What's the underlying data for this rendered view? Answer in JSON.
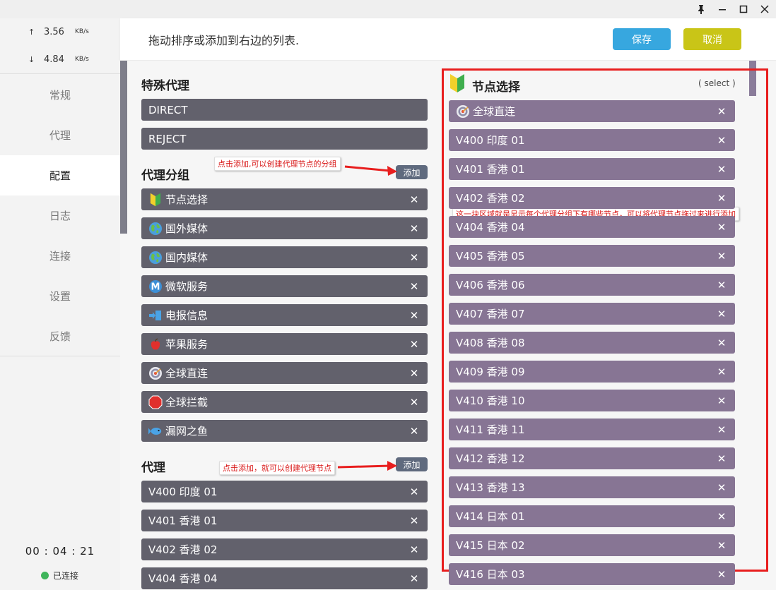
{
  "window": {
    "pin_icon": "pin-icon",
    "min_icon": "minimize-icon",
    "max_icon": "maximize-icon",
    "close_icon": "close-icon"
  },
  "sidebar": {
    "upload": {
      "arrow": "↑",
      "value": "3.56",
      "unit": "KB/s"
    },
    "download": {
      "arrow": "↓",
      "value": "4.84",
      "unit": "KB/s"
    },
    "menu": [
      {
        "label": "常规",
        "active": false
      },
      {
        "label": "代理",
        "active": false
      },
      {
        "label": "配置",
        "active": true
      },
      {
        "label": "日志",
        "active": false
      },
      {
        "label": "连接",
        "active": false
      },
      {
        "label": "设置",
        "active": false
      },
      {
        "label": "反馈",
        "active": false
      }
    ],
    "timer": "00 : 04 : 21",
    "status": "已连接",
    "status_color": "#3fb55b"
  },
  "header": {
    "title": "拖动排序或添加到右边的列表.",
    "save_label": "保存",
    "cancel_label": "取消",
    "save_color": "#37a7df",
    "cancel_color": "#c9c517"
  },
  "special": {
    "title": "特殊代理",
    "items": [
      "DIRECT",
      "REJECT"
    ]
  },
  "groups": {
    "title": "代理分组",
    "add_label": "添加",
    "callout": "点击添加,可以创建代理节点的分组",
    "items": [
      {
        "label": "节点选择",
        "icon": "beginner-badge-icon"
      },
      {
        "label": "国外媒体",
        "icon": "globe-icon"
      },
      {
        "label": "国内媒体",
        "icon": "globe-icon"
      },
      {
        "label": "微软服务",
        "icon": "letter-m-icon"
      },
      {
        "label": "电报信息",
        "icon": "arrow-in-icon"
      },
      {
        "label": "苹果服务",
        "icon": "apple-icon"
      },
      {
        "label": "全球直连",
        "icon": "target-icon"
      },
      {
        "label": "全球拦截",
        "icon": "stop-sign-icon"
      },
      {
        "label": "漏网之鱼",
        "icon": "fish-icon"
      }
    ]
  },
  "proxies": {
    "title": "代理",
    "add_label": "添加",
    "callout": "点击添加，就可以创建代理节点",
    "items": [
      "V400 印度 01",
      "V401 香港 01",
      "V402 香港 02",
      "V404 香港 04"
    ]
  },
  "selected": {
    "title": "节点选择",
    "tag": "( select )",
    "callout": "这一块区域就是显示每个代理分组下有哪些节点，可以将代理节点拖过来进行添加",
    "items": [
      {
        "label": "全球直连",
        "icon": "target-icon"
      },
      {
        "label": "V400 印度 01"
      },
      {
        "label": "V401 香港 01"
      },
      {
        "label": "V402 香港 02"
      },
      {
        "label": "V404 香港 04"
      },
      {
        "label": "V405 香港 05"
      },
      {
        "label": "V406 香港 06"
      },
      {
        "label": "V407 香港 07"
      },
      {
        "label": "V408 香港 08"
      },
      {
        "label": "V409 香港 09"
      },
      {
        "label": "V410 香港 10"
      },
      {
        "label": "V411 香港 11"
      },
      {
        "label": "V412 香港 12"
      },
      {
        "label": "V413 香港 13"
      },
      {
        "label": "V414 日本 01"
      },
      {
        "label": "V415 日本 02"
      },
      {
        "label": "V416 日本 03"
      }
    ]
  },
  "close_glyph": "✕",
  "annotation_color": "#e81e1e"
}
